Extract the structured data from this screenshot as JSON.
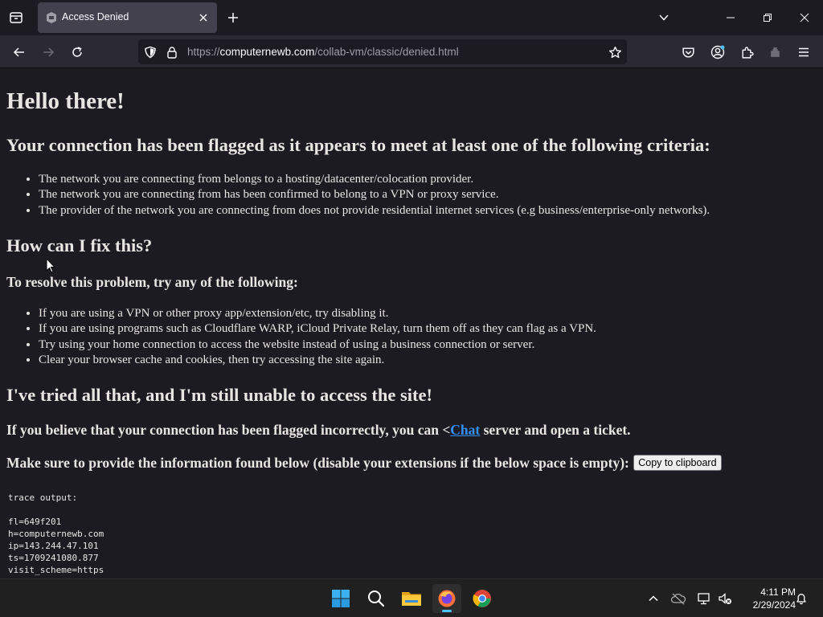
{
  "browser": {
    "tab_title": "Access Denied",
    "url_scheme": "https://",
    "url_host": "computernewb.com",
    "url_path": "/collab-vm/classic/denied.html"
  },
  "page": {
    "heading": "Hello there!",
    "flagged_heading": "Your connection has been flagged as it appears to meet at least one of the following criteria:",
    "criteria": [
      "The network you are connecting from belongs to a hosting/datacenter/colocation provider.",
      "The network you are connecting from has been confirmed to belong to a VPN or proxy service.",
      "The provider of the network you are connecting from does not provide residential internet services (e.g business/enterprise-only networks)."
    ],
    "fix_heading": "How can I fix this?",
    "resolve_heading": "To resolve this problem, try any of the following:",
    "fixes": [
      "If you are using a VPN or other proxy app/extension/etc, try disabling it.",
      "If you are using programs such as Cloudflare WARP, iCloud Private Relay, turn them off as they can flag as a VPN.",
      "Try using your home connection to access the website instead of using a business connection or server.",
      "Clear your browser cache and cookies, then try accessing the site again."
    ],
    "tried_heading": "I've tried all that, and I'm still unable to access the site!",
    "incorrect_prefix": "If you believe that your connection has been flagged incorrectly, you can <",
    "chat_link": "Chat",
    "incorrect_suffix": " server and open a ticket.",
    "provide_info": "Make sure to provide the information found below (disable your extensions if the below space is empty):",
    "copy_button": "Copy to clipboard",
    "trace_output": "trace output:\n\nfl=649f201\nh=computernewb.com\nip=143.244.47.101\nts=1709241080.877\nvisit_scheme=https"
  },
  "taskbar": {
    "time": "4:11 PM",
    "date": "2/29/2024"
  },
  "colors": {
    "accent": "#4cc2ff",
    "link": "#3391ff",
    "page_bg": "#1c1b22"
  }
}
